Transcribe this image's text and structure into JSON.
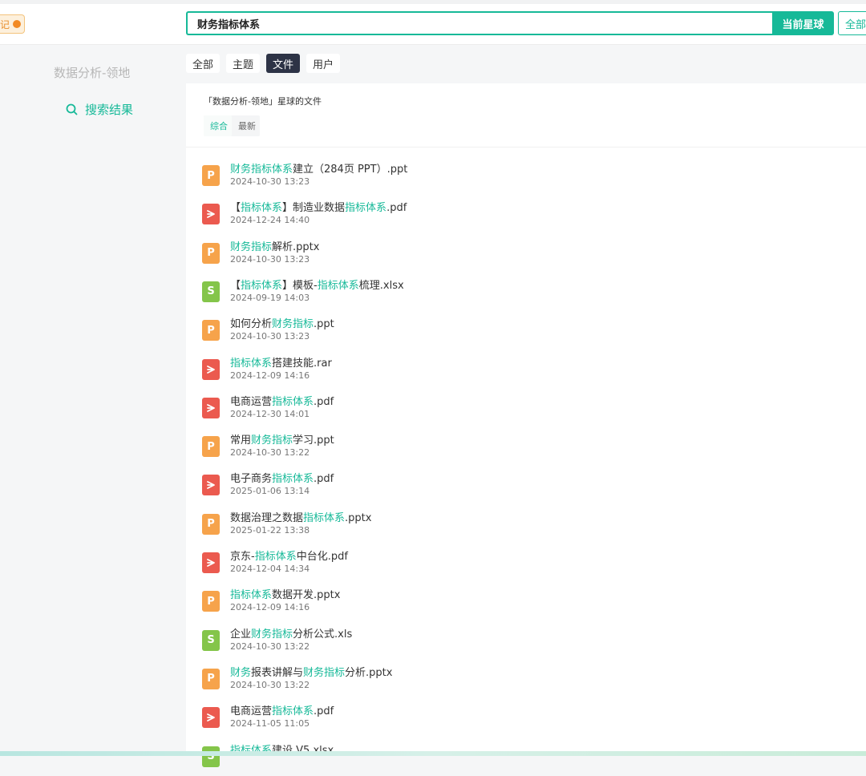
{
  "header": {
    "left_tag_label": "记",
    "search_value": "财务指标体系",
    "btn_current": "当前星球",
    "btn_all": "全部"
  },
  "sidebar": {
    "group_name": "数据分析-领地",
    "result_label": "搜索结果"
  },
  "tabs": [
    "全部",
    "主题",
    "文件",
    "用户"
  ],
  "active_tab": "文件",
  "panel": {
    "title": "「数据分析-领地」星球的文件",
    "sort_tabs": [
      "综合",
      "最新"
    ]
  },
  "colors": {
    "accent": "#16b998",
    "ppt": "#f6a34b",
    "pdf": "#eb5a4f",
    "xls": "#84c54a",
    "dark_tab": "#2d3346"
  },
  "files": [
    {
      "type": "ppt",
      "parts": [
        [
          "财务指标体系",
          1
        ],
        [
          "建立（284页 PPT）.ppt",
          0
        ]
      ],
      "date": "2024-10-30 13:23"
    },
    {
      "type": "pdf",
      "parts": [
        [
          "【",
          0
        ],
        [
          "指标体系",
          1
        ],
        [
          "】制造业数据",
          0
        ],
        [
          "指标体系",
          1
        ],
        [
          ".pdf",
          0
        ]
      ],
      "date": "2024-12-24 14:40"
    },
    {
      "type": "ppt",
      "parts": [
        [
          "财务指标",
          1
        ],
        [
          "解析.pptx",
          0
        ]
      ],
      "date": "2024-10-30 13:23"
    },
    {
      "type": "xls",
      "parts": [
        [
          "【",
          0
        ],
        [
          "指标体系",
          1
        ],
        [
          "】模板-",
          0
        ],
        [
          "指标体系",
          1
        ],
        [
          "梳理.xlsx",
          0
        ]
      ],
      "date": "2024-09-19 14:03"
    },
    {
      "type": "ppt",
      "parts": [
        [
          "如何分析",
          0
        ],
        [
          "财务指标",
          1
        ],
        [
          ".ppt",
          0
        ]
      ],
      "date": "2024-10-30 13:23"
    },
    {
      "type": "pdf",
      "parts": [
        [
          "指标体系",
          1
        ],
        [
          "搭建技能.rar",
          0
        ]
      ],
      "date": "2024-12-09 14:16"
    },
    {
      "type": "pdf",
      "parts": [
        [
          "电商运营",
          0
        ],
        [
          "指标体系",
          1
        ],
        [
          ".pdf",
          0
        ]
      ],
      "date": "2024-12-30 14:01"
    },
    {
      "type": "ppt",
      "parts": [
        [
          "常用",
          0
        ],
        [
          "财务指标",
          1
        ],
        [
          "学习.ppt",
          0
        ]
      ],
      "date": "2024-10-30 13:22"
    },
    {
      "type": "pdf",
      "parts": [
        [
          "电子商务",
          0
        ],
        [
          "指标体系",
          1
        ],
        [
          ".pdf",
          0
        ]
      ],
      "date": "2025-01-06 13:14"
    },
    {
      "type": "ppt",
      "parts": [
        [
          "数据治理之数据",
          0
        ],
        [
          "指标体系",
          1
        ],
        [
          ".pptx",
          0
        ]
      ],
      "date": "2025-01-22 13:38"
    },
    {
      "type": "pdf",
      "parts": [
        [
          "京东-",
          0
        ],
        [
          "指标体系",
          1
        ],
        [
          "中台化.pdf",
          0
        ]
      ],
      "date": "2024-12-04 14:34"
    },
    {
      "type": "ppt",
      "parts": [
        [
          "指标体系",
          1
        ],
        [
          "数据开发.pptx",
          0
        ]
      ],
      "date": "2024-12-09 14:16"
    },
    {
      "type": "xls",
      "parts": [
        [
          "企业",
          0
        ],
        [
          "财务指标",
          1
        ],
        [
          "分析公式.xls",
          0
        ]
      ],
      "date": "2024-10-30 13:22"
    },
    {
      "type": "ppt",
      "parts": [
        [
          "财务",
          1
        ],
        [
          "报表讲解与",
          0
        ],
        [
          "财务指标",
          1
        ],
        [
          "分析.pptx",
          0
        ]
      ],
      "date": "2024-10-30 13:22"
    },
    {
      "type": "pdf",
      "parts": [
        [
          "电商运营",
          0
        ],
        [
          "指标体系",
          1
        ],
        [
          ".pdf",
          0
        ]
      ],
      "date": "2024-11-05 11:05"
    },
    {
      "type": "xls",
      "parts": [
        [
          "指标体系",
          1
        ],
        [
          "建设 V5.xlsx",
          0
        ]
      ],
      "date": ""
    }
  ]
}
